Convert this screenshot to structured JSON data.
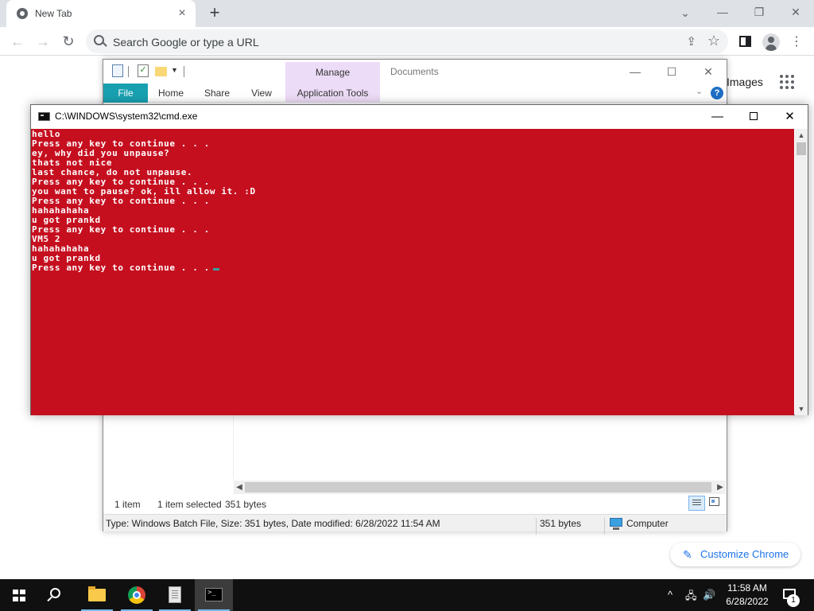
{
  "chrome": {
    "tab_title": "New Tab",
    "tab_close": "×",
    "new_tab": "+",
    "tab_search": "⌄",
    "window_controls": {
      "minimize": "—",
      "restore": "❐",
      "close": "✕"
    },
    "nav": {
      "back": "←",
      "forward": "→",
      "reload": "↻"
    },
    "omnibox_placeholder": "Search Google or type a URL",
    "icons": [
      "search-icon",
      "share-icon",
      "star-icon",
      "side-panel-icon",
      "profile-icon",
      "menu-icon"
    ],
    "menu": "⋮",
    "ntp_images_link": "Images",
    "customize_label": "Customize Chrome"
  },
  "explorer": {
    "manage_tab": "Manage",
    "title": "Documents",
    "ribbon_tabs": [
      "File",
      "Home",
      "Share",
      "View",
      "Application Tools"
    ],
    "window_controls": {
      "minimize": "—",
      "maximize": "☐",
      "close": "✕"
    },
    "status": {
      "items": "1 item",
      "selected": "1 item selected",
      "size": "351 bytes"
    },
    "infobar": {
      "details": "Type: Windows Batch File, Size: 351 bytes, Date modified: 6/28/2022 11:54 AM",
      "size": "351 bytes",
      "location": "Computer"
    }
  },
  "cmd": {
    "title": "C:\\WINDOWS\\system32\\cmd.exe",
    "window_controls": {
      "minimize": "—",
      "close": "✕"
    },
    "background_color": "#c50f1f",
    "text_color": "#ffffff",
    "lines": [
      "hello",
      "Press any key to continue . . .",
      "ey, why did you unpause?",
      "thats not nice",
      "last chance, do not unpause.",
      "Press any key to continue . . .",
      "you want to pause? ok, ill allow it. :D",
      "Press any key to continue . . .",
      "hahahahaha",
      "u got prankd",
      "Press any key to continue . . .",
      "VM5 2",
      "hahahahaha",
      "u got prankd",
      "Press any key to continue . . ."
    ]
  },
  "taskbar": {
    "apps": [
      "start-icon",
      "search-icon",
      "file-explorer-icon",
      "chrome-icon",
      "notepad-icon",
      "cmd-icon"
    ],
    "tray": {
      "chevron": "^",
      "network": "🖧",
      "volume": "🔊"
    },
    "time": "11:58 AM",
    "date": "6/28/2022",
    "notification_count": "1"
  }
}
